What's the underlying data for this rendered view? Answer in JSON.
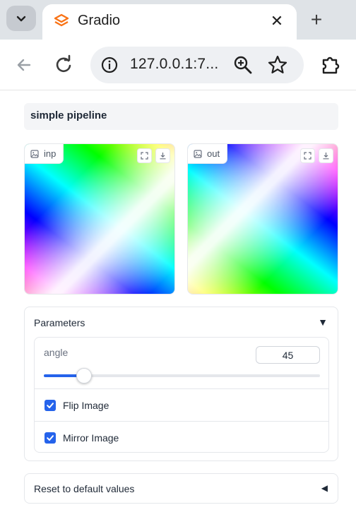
{
  "browser": {
    "tab_title": "Gradio",
    "url": "127.0.0.1:7...",
    "tab_close": "✕",
    "new_tab": "+",
    "favicon_color": "#f97316"
  },
  "app": {
    "textbox_value": "simple pipeline",
    "images": {
      "input_label": "inp",
      "output_label": "out"
    },
    "parameters": {
      "title": "Parameters",
      "caret": "▼",
      "angle": {
        "label": "angle",
        "value": "45",
        "min": 0,
        "max": 360,
        "position": 0.145
      },
      "flip": {
        "label": "Flip Image",
        "checked": true
      },
      "mirror": {
        "label": "Mirror Image",
        "checked": true
      }
    },
    "reset": {
      "label": "Reset to default values",
      "caret": "◀"
    },
    "accent_color": "#2563eb"
  }
}
